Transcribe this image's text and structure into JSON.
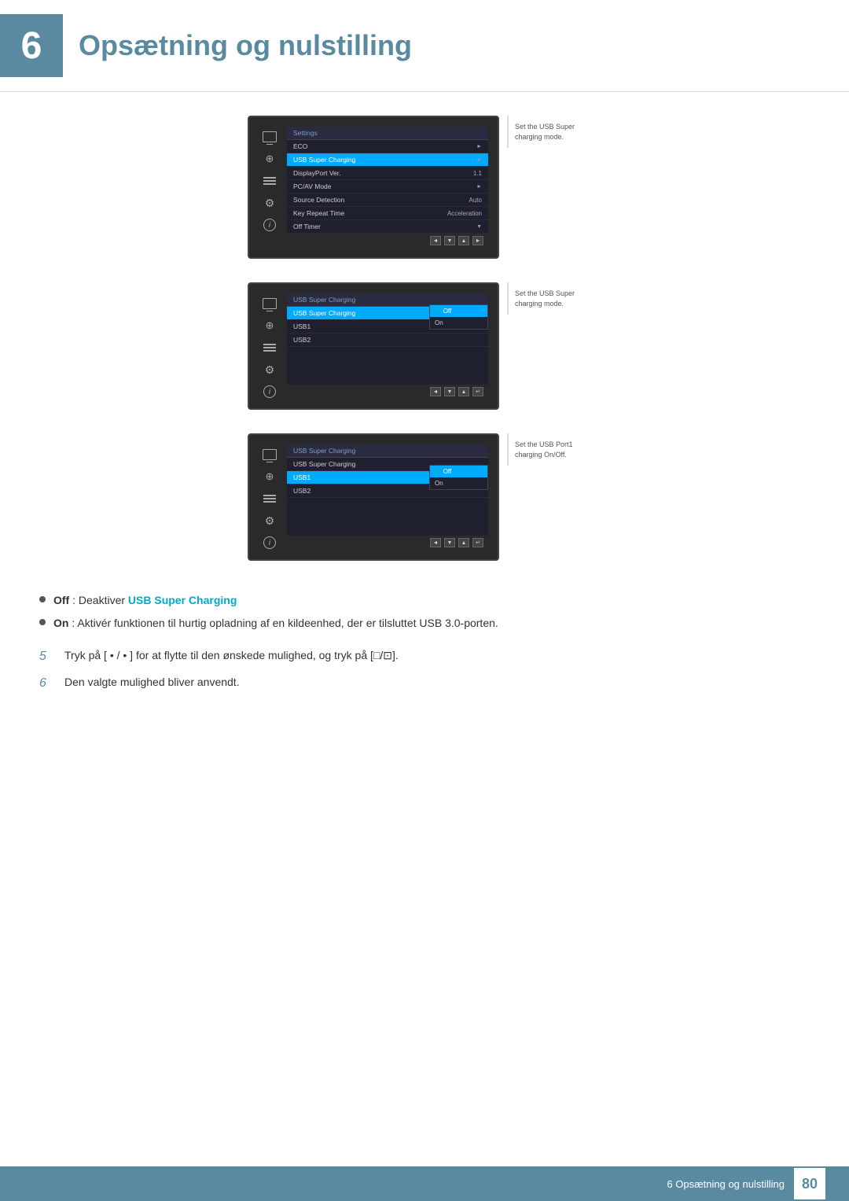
{
  "header": {
    "chapter_num": "6",
    "title": "Opsætning og nulstilling"
  },
  "panels": [
    {
      "id": "panel1",
      "help_text": "Set the USB Super charging mode.",
      "menu_title": "Settings",
      "menu_items": [
        {
          "label": "ECO",
          "value": "",
          "arrow": true,
          "highlighted": false
        },
        {
          "label": "USB Super Charging",
          "value": "",
          "arrow": true,
          "highlighted": true
        },
        {
          "label": "DisplayPort Ver.",
          "value": "1.1",
          "arrow": false,
          "highlighted": false
        },
        {
          "label": "PC/AV Mode",
          "value": "",
          "arrow": true,
          "highlighted": false
        },
        {
          "label": "Source Detection",
          "value": "Auto",
          "arrow": false,
          "highlighted": false
        },
        {
          "label": "Key Repeat Time",
          "value": "Acceleration",
          "arrow": false,
          "highlighted": false
        },
        {
          "label": "Off Timer",
          "value": "",
          "arrow": true,
          "highlighted": false
        }
      ],
      "controls": [
        "◄",
        "▼",
        "▲",
        "►"
      ]
    },
    {
      "id": "panel2",
      "help_text": "Set the USB Super charging mode.",
      "menu_title": "USB Super Charging",
      "menu_items": [
        {
          "label": "USB Super Charging",
          "value": "",
          "arrow": false,
          "highlighted": true
        }
      ],
      "submenu": [
        {
          "label": "Off",
          "checked": true
        },
        {
          "label": "On",
          "checked": false
        }
      ],
      "sub_items": [
        {
          "label": "USB1"
        },
        {
          "label": "USB2"
        }
      ],
      "controls": [
        "◄",
        "▼",
        "▲",
        "↵"
      ]
    },
    {
      "id": "panel3",
      "help_text": "Set the USB Port1 charging On/Off.",
      "menu_title": "USB Super Charging",
      "menu_items": [
        {
          "label": "USB Super Charging",
          "value": "",
          "highlighted": false
        },
        {
          "label": "USB1",
          "value": "",
          "highlighted": true
        },
        {
          "label": "USB2",
          "value": "",
          "highlighted": false
        }
      ],
      "submenu": [
        {
          "label": "Off",
          "checked": true
        },
        {
          "label": "On",
          "checked": false
        }
      ],
      "controls": [
        "◄",
        "▼",
        "▲",
        "↵"
      ]
    }
  ],
  "bullets": [
    {
      "label_bold": "Off",
      "text_before": "",
      "text_after": ": Deaktiver ",
      "highlight": "USB Super Charging",
      "text_end": ""
    },
    {
      "label_bold": "On",
      "text_before": "",
      "text_after": ": Aktivér funktionen til hurtig opladning af en kildeenhed, der er tilsluttet USB 3.0-porten.",
      "highlight": "",
      "text_end": ""
    }
  ],
  "steps": [
    {
      "num": "5",
      "text": "Tryk på [ • / • ] for at flytte til den ønskede mulighed, og tryk på [□/⊡]."
    },
    {
      "num": "6",
      "text": "Den valgte mulighed bliver anvendt."
    }
  ],
  "footer": {
    "text": "6 Opsætning og nulstilling",
    "page": "80"
  }
}
